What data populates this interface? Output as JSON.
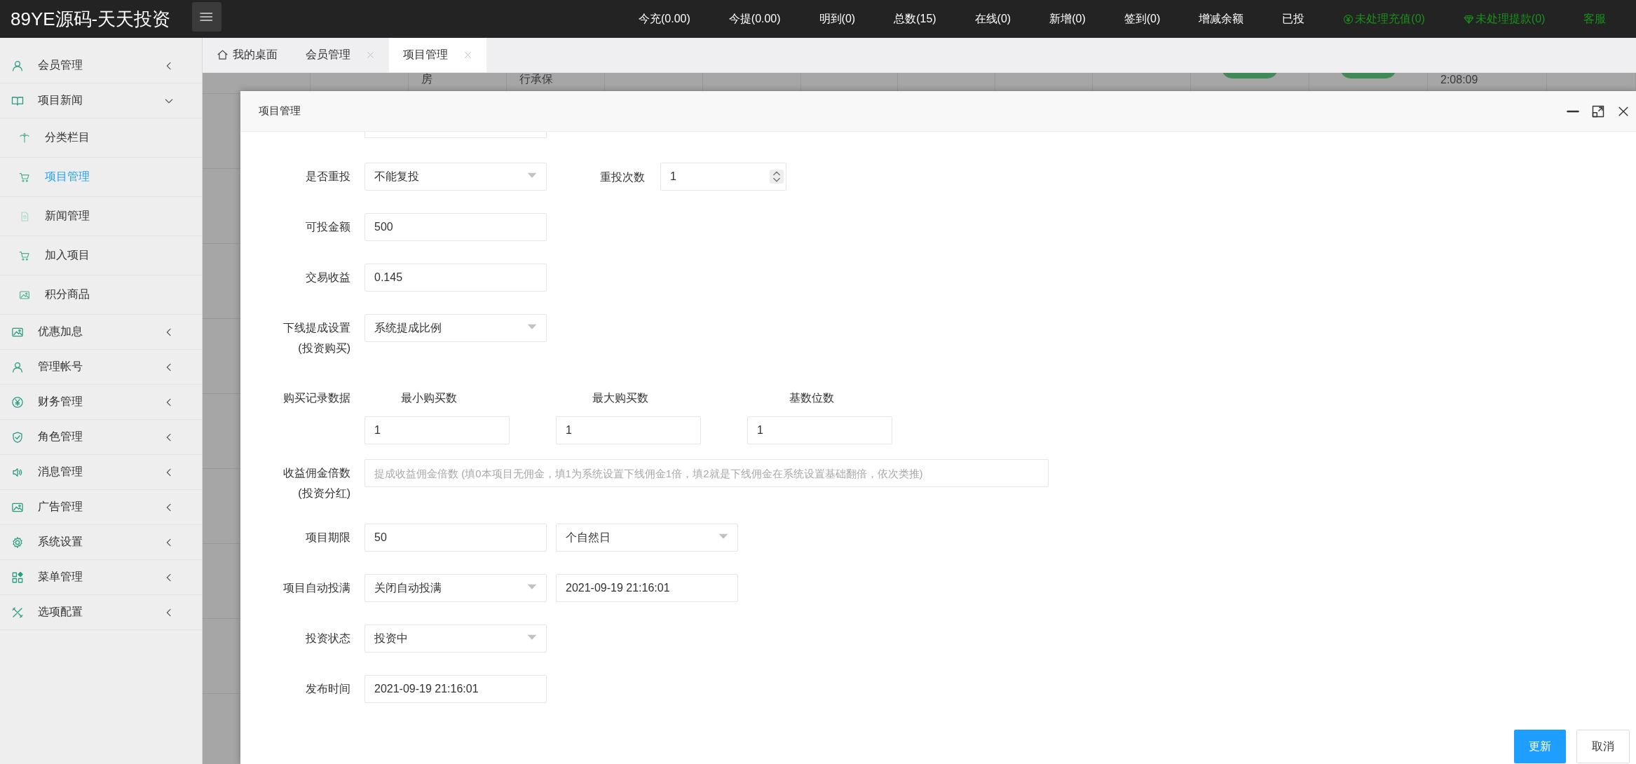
{
  "topbar": {
    "logo": "89YE源码-天天投资",
    "nav": [
      {
        "label": "今充(0.00)",
        "kind": "plain"
      },
      {
        "label": "今提(0.00)",
        "kind": "plain"
      },
      {
        "label": "明到(0)",
        "kind": "plain"
      },
      {
        "label": "总数(15)",
        "kind": "plain"
      },
      {
        "label": "在线(0)",
        "kind": "plain"
      },
      {
        "label": "新增(0)",
        "kind": "plain"
      },
      {
        "label": "签到(0)",
        "kind": "plain"
      },
      {
        "label": "增减余额",
        "kind": "plain"
      },
      {
        "label": "已投",
        "kind": "plain"
      },
      {
        "label": "未处理充值(0)",
        "kind": "recharge"
      },
      {
        "label": "未处理提款(0)",
        "kind": "withdraw"
      },
      {
        "label": "客服",
        "kind": "link"
      }
    ]
  },
  "sidebar": {
    "items": [
      {
        "label": "会员管理",
        "expanded": false
      },
      {
        "label": "项目新闻",
        "expanded": true,
        "children": [
          {
            "label": "分类栏目",
            "selected": false
          },
          {
            "label": "项目管理",
            "selected": true
          },
          {
            "label": "新闻管理",
            "selected": false
          },
          {
            "label": "加入项目",
            "selected": false
          },
          {
            "label": "积分商品",
            "selected": false
          }
        ]
      },
      {
        "label": "优惠加息",
        "expanded": false
      },
      {
        "label": "管理帐号",
        "expanded": false
      },
      {
        "label": "财务管理",
        "expanded": false
      },
      {
        "label": "角色管理",
        "expanded": false
      },
      {
        "label": "消息管理",
        "expanded": false
      },
      {
        "label": "广告管理",
        "expanded": false
      },
      {
        "label": "系统设置",
        "expanded": false
      },
      {
        "label": "菜单管理",
        "expanded": false
      },
      {
        "label": "选项配置",
        "expanded": false
      }
    ]
  },
  "tabs": [
    {
      "label": "我的桌面",
      "kind": "home",
      "selected": false
    },
    {
      "label": "会员管理",
      "kind": "closable",
      "selected": false
    },
    {
      "label": "项目管理",
      "kind": "closable",
      "selected": true
    }
  ],
  "background_row": {
    "column_3": "房",
    "column_4": "行承保",
    "toggles": [
      {
        "on": true
      },
      {
        "on": true
      }
    ],
    "column_13": "2:08:09"
  },
  "dialog": {
    "title": "项目管理",
    "rows": [
      {
        "label": "是否重投",
        "fields": [
          {
            "kind": "select",
            "value": "不能复投"
          },
          {
            "kind": "label",
            "text": "重投次数"
          },
          {
            "kind": "number",
            "value": "1"
          }
        ]
      },
      {
        "label": "可投金额",
        "fields": [
          {
            "kind": "input",
            "value": "500"
          }
        ]
      },
      {
        "label": "交易收益",
        "fields": [
          {
            "kind": "input",
            "value": "0.145"
          }
        ]
      },
      {
        "label": "下线提成设置",
        "sublabel": "(投资购买)",
        "fields": [
          {
            "kind": "select",
            "value": "系统提成比例"
          }
        ]
      },
      {
        "label": "购买记录数据",
        "columns": [
          {
            "heading": "最小购买数",
            "value": "1"
          },
          {
            "heading": "最大购买数",
            "value": "1"
          },
          {
            "heading": "基数位数",
            "value": "1"
          }
        ]
      },
      {
        "label": "收益佣金倍数",
        "sublabel": "(投资分红)",
        "fields": [
          {
            "kind": "wide",
            "placeholder": "提成收益佣金倍数 (填0本项目无佣金，填1为系统设置下线佣金1倍，填2就是下线佣金在系统设置基础翻倍，依次类推)"
          }
        ]
      },
      {
        "label": "项目期限",
        "fields": [
          {
            "kind": "input",
            "value": "50"
          },
          {
            "kind": "select",
            "value": "个自然日"
          }
        ]
      },
      {
        "label": "项目自动投满",
        "fields": [
          {
            "kind": "select",
            "value": "关闭自动投满"
          },
          {
            "kind": "input",
            "value": "2021-09-19 21:16:01"
          }
        ]
      },
      {
        "label": "投资状态",
        "fields": [
          {
            "kind": "select",
            "value": "投资中"
          }
        ]
      },
      {
        "label": "发布时间",
        "fields": [
          {
            "kind": "input",
            "value": "2021-09-19 21:16:01"
          }
        ]
      }
    ],
    "buttons": [
      {
        "label": "更新",
        "kind": "primary"
      },
      {
        "label": "取消",
        "kind": "default"
      }
    ]
  }
}
